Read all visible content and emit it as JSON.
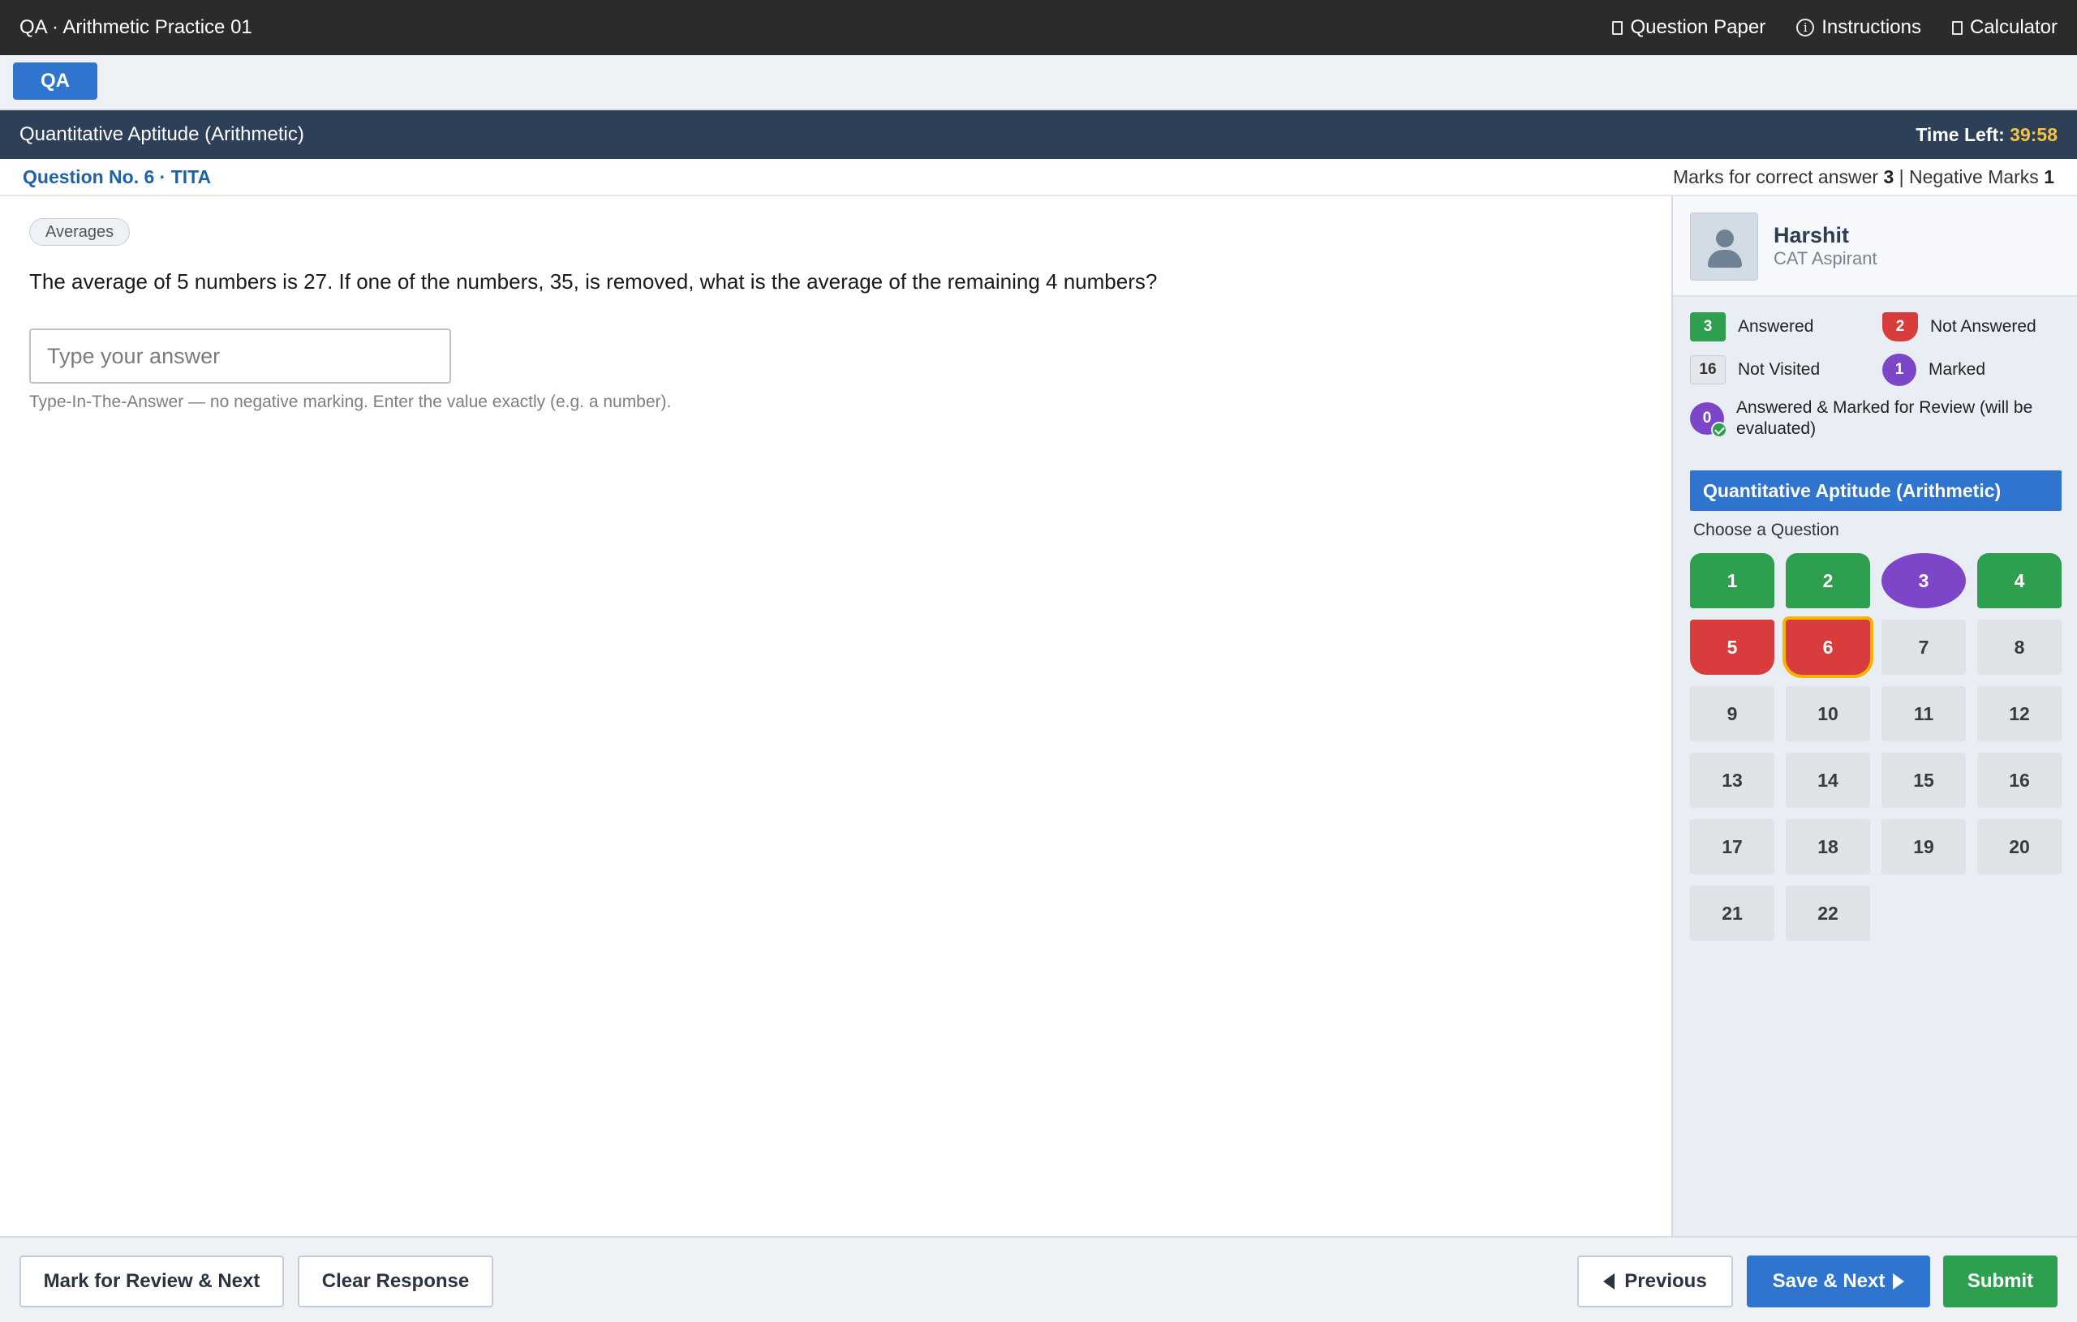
{
  "topbar": {
    "title": "QA · Arithmetic Practice 01",
    "links": {
      "question_paper": "Question Paper",
      "instructions": "Instructions",
      "calculator": "Calculator"
    }
  },
  "section_tab": "QA",
  "subject_bar": {
    "subject": "Quantitative Aptitude (Arithmetic)",
    "time_label": "Time Left:",
    "time_value": "39:58"
  },
  "question_header": {
    "number_text": "Question No. 6 · TITA",
    "marks_correct_label": "Marks for correct answer",
    "marks_correct_value": "3",
    "separator": "|",
    "negative_label": "Negative Marks",
    "negative_value": "1"
  },
  "question": {
    "topic": "Averages",
    "text": "The average of 5 numbers is 27. If one of the numbers, 35, is removed, what is the average of the remaining 4 numbers?",
    "answer_value": "",
    "answer_placeholder": "Type your answer",
    "hint": "Type-In-The-Answer — no negative marking. Enter the value exactly (e.g. a number)."
  },
  "profile": {
    "name": "Harshit",
    "role": "CAT Aspirant"
  },
  "legend": {
    "answered": {
      "count": "3",
      "label": "Answered"
    },
    "not_answered": {
      "count": "2",
      "label": "Not Answered"
    },
    "not_visited": {
      "count": "16",
      "label": "Not Visited"
    },
    "marked": {
      "count": "1",
      "label": "Marked"
    },
    "answered_marked": {
      "count": "0",
      "label": "Answered & Marked for Review (will be evaluated)"
    }
  },
  "palette": {
    "header": "Quantitative Aptitude (Arithmetic)",
    "choose_label": "Choose a Question",
    "questions": [
      {
        "n": "1",
        "status": "answered"
      },
      {
        "n": "2",
        "status": "answered"
      },
      {
        "n": "3",
        "status": "marked"
      },
      {
        "n": "4",
        "status": "answered"
      },
      {
        "n": "5",
        "status": "not-answered"
      },
      {
        "n": "6",
        "status": "not-answered",
        "current": true
      },
      {
        "n": "7",
        "status": "not-visited"
      },
      {
        "n": "8",
        "status": "not-visited"
      },
      {
        "n": "9",
        "status": "not-visited"
      },
      {
        "n": "10",
        "status": "not-visited"
      },
      {
        "n": "11",
        "status": "not-visited"
      },
      {
        "n": "12",
        "status": "not-visited"
      },
      {
        "n": "13",
        "status": "not-visited"
      },
      {
        "n": "14",
        "status": "not-visited"
      },
      {
        "n": "15",
        "status": "not-visited"
      },
      {
        "n": "16",
        "status": "not-visited"
      },
      {
        "n": "17",
        "status": "not-visited"
      },
      {
        "n": "18",
        "status": "not-visited"
      },
      {
        "n": "19",
        "status": "not-visited"
      },
      {
        "n": "20",
        "status": "not-visited"
      },
      {
        "n": "21",
        "status": "not-visited"
      },
      {
        "n": "22",
        "status": "not-visited"
      }
    ]
  },
  "footer": {
    "mark_review_next": "Mark for Review & Next",
    "clear_response": "Clear Response",
    "previous": "Previous",
    "save_next": "Save & Next",
    "submit": "Submit"
  },
  "colors": {
    "answered": "#2e9e4f",
    "not_answered": "#d93c3c",
    "marked": "#7d46c8",
    "primary": "#2f74cf",
    "timer": "#f5c242",
    "current_outline": "#f5b400"
  },
  "icons": {
    "question_paper": "document-icon",
    "instructions": "info-icon",
    "calculator": "calculator-icon",
    "previous": "caret-left-icon",
    "save_next": "caret-right-icon",
    "avatar": "user-avatar-icon"
  }
}
